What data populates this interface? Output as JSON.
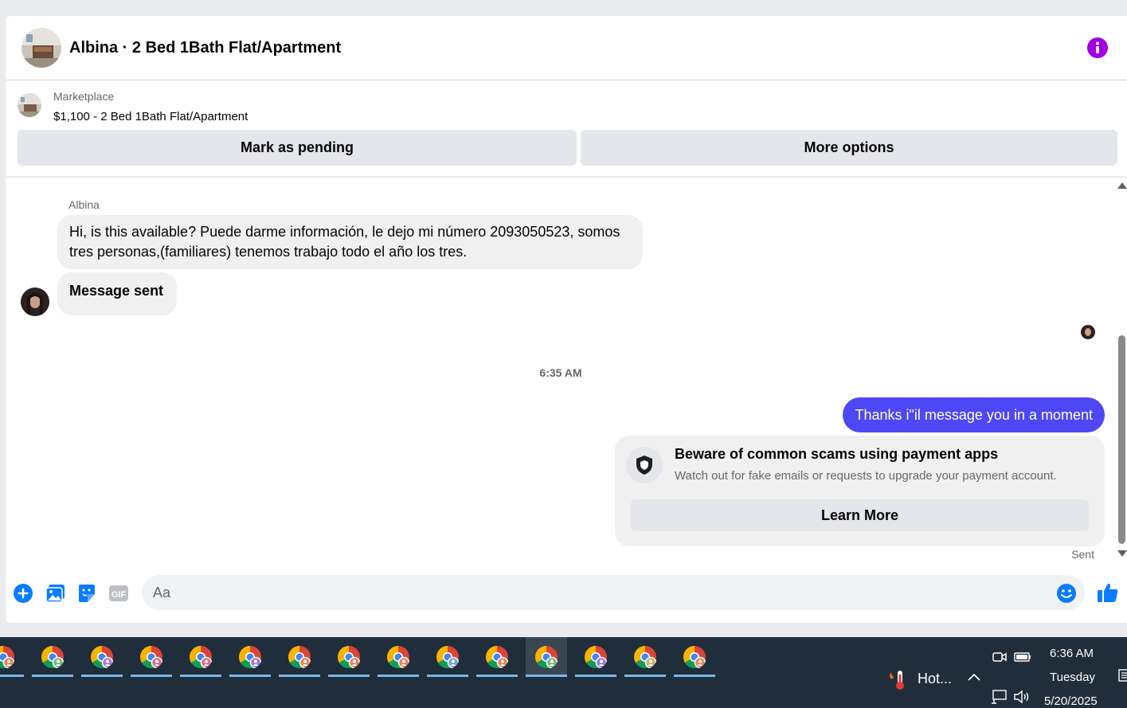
{
  "conversation": {
    "title": "Albina · 2 Bed 1Bath Flat/Apartment"
  },
  "listing": {
    "source": "Marketplace",
    "price_title": "$1,100 - 2 Bed 1Bath Flat/Apartment",
    "mark_pending_label": "Mark as pending",
    "more_options_label": "More options"
  },
  "messages": {
    "sender_name": "Albina",
    "incoming_1": "Hi, is this available? Puede darme información, le dejo mi número 2093050523, somos tres personas,(familiares) tenemos trabajo todo el año los tres.",
    "incoming_2": "Message sent",
    "time_separator": "6:35 AM",
    "outgoing_1": "Thanks i\"il message you in a moment",
    "sent_status": "Sent"
  },
  "scam_warning": {
    "heading": "Beware of common scams using payment apps",
    "body": "Watch out for fake emails or requests to upgrade your payment account.",
    "learn_more_label": "Learn More"
  },
  "composer": {
    "placeholder": "Aa",
    "value": "",
    "gif_label": "GIF"
  },
  "taskbar": {
    "weather_label": "Hot...",
    "time": "6:36 AM",
    "day": "Tuesday",
    "date": "5/20/2025",
    "apps": [
      {
        "name": "chrome-profile-1",
        "badge": "#e8845c"
      },
      {
        "name": "chrome-profile-2",
        "badge": "#7ab87a"
      },
      {
        "name": "chrome-profile-3",
        "badge": "#b07ad4"
      },
      {
        "name": "chrome-profile-4",
        "badge": "#e06b8f"
      },
      {
        "name": "chrome-profile-5",
        "badge": "#e06b8f"
      },
      {
        "name": "chrome-profile-6",
        "badge": "#9c7ad4"
      },
      {
        "name": "chrome-profile-7",
        "badge": "#e8845c"
      },
      {
        "name": "chrome-profile-8",
        "badge": "#e8845c"
      },
      {
        "name": "chrome-profile-9",
        "badge": "#e8845c"
      },
      {
        "name": "chrome-profile-10",
        "badge": "#7aa0d4"
      },
      {
        "name": "chrome-profile-11",
        "badge": "#e8845c"
      },
      {
        "name": "chrome-profile-12",
        "badge": "#7ab87a"
      },
      {
        "name": "chrome-profile-13",
        "badge": "#9c7ad4"
      },
      {
        "name": "chrome-profile-14",
        "badge": "#c9b06a"
      },
      {
        "name": "chrome-profile-15",
        "badge": "#e8845c"
      }
    ]
  },
  "colors": {
    "messenger_accent": "#0a7cff",
    "outgoing_bubble": "#4d47f5",
    "info_icon": "#a000e0",
    "taskbar_bg": "#202d3a",
    "taskbar_underline": "#76b9ed"
  }
}
